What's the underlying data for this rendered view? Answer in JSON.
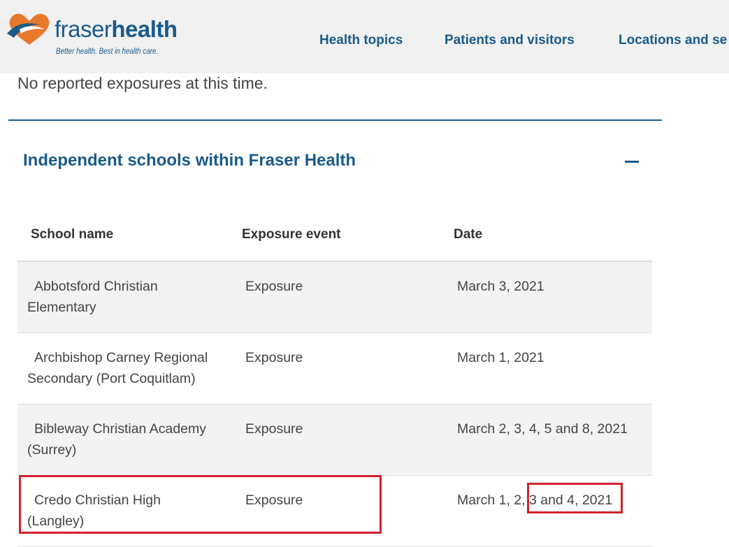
{
  "header": {
    "logo": {
      "word_light": "fraser",
      "word_bold": "health",
      "tagline": "Better health. Best in health care.",
      "icon": "heart-swoosh-icon"
    },
    "nav": [
      {
        "label": "Health topics"
      },
      {
        "label": "Patients and visitors"
      },
      {
        "label": "Locations and se"
      }
    ]
  },
  "main": {
    "notice": "No reported exposures at this time.",
    "section": {
      "title": "Independent schools within Fraser Health",
      "toggle_icon": "minus-collapse-icon"
    },
    "table": {
      "headers": [
        "School name",
        "Exposure event",
        "Date"
      ],
      "rows": [
        {
          "school_line1": "Abbotsford Christian",
          "school_line2": "Elementary",
          "event": "Exposure",
          "date": "March 3, 2021"
        },
        {
          "school_line1": "Archbishop Carney Regional",
          "school_line2": "Secondary (Port Coquitlam)",
          "event": "Exposure",
          "date": "March 1, 2021"
        },
        {
          "school_line1": "Bibleway Christian Academy",
          "school_line2": "(Surrey)",
          "event": "Exposure",
          "date": "March 2, 3, 4, 5 and 8, 2021"
        },
        {
          "school_line1": "Credo Christian High",
          "school_line2": "(Langley)",
          "event": "Exposure",
          "date": "March 1, 2, 3 and 4, 2021"
        }
      ]
    }
  },
  "colors": {
    "brand_blue": "#1a5a8a",
    "brand_orange": "#e8792b",
    "highlight_red": "#d3212f",
    "header_bg": "#f1f1f1",
    "row_alt_bg": "#f3f3f3"
  }
}
